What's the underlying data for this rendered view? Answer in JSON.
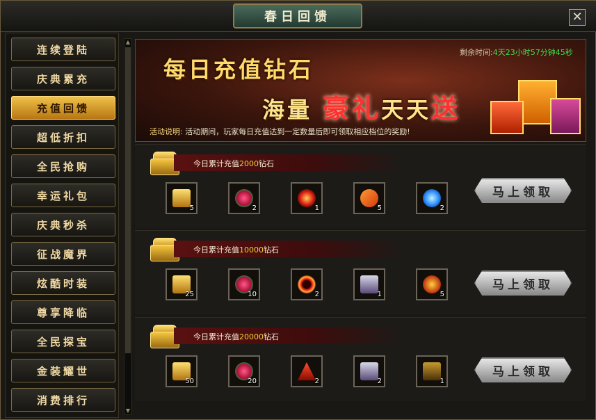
{
  "window": {
    "title": "春日回馈",
    "close_glyph": "✕"
  },
  "sidebar": {
    "items": [
      {
        "label": "连续登陆",
        "active": false
      },
      {
        "label": "庆典累充",
        "active": false
      },
      {
        "label": "充值回馈",
        "active": true
      },
      {
        "label": "超低折扣",
        "active": false
      },
      {
        "label": "全民抢购",
        "active": false
      },
      {
        "label": "幸运礼包",
        "active": false
      },
      {
        "label": "庆典秒杀",
        "active": false
      },
      {
        "label": "征战魔界",
        "active": false
      },
      {
        "label": "炫酷时装",
        "active": false
      },
      {
        "label": "尊享降临",
        "active": false
      },
      {
        "label": "全民探宝",
        "active": false
      },
      {
        "label": "金装耀世",
        "active": false
      },
      {
        "label": "消费排行",
        "active": false
      }
    ]
  },
  "banner": {
    "line1": "每日充值钻石",
    "line2_prefix": "海量",
    "line2_hot": "豪礼",
    "line2_mid": "天天",
    "line2_end": "送",
    "timer_label": "剩余时间:",
    "timer_value": "4天23小时57分钟45秒",
    "desc_label": "活动说明:",
    "desc_text": "活动期间，玩家每日充值达到一定数量后即可领取相应档位的奖励!"
  },
  "tiers": [
    {
      "prefix": "今日累计充值",
      "amount": "2000",
      "suffix": "钻石",
      "rewards": [
        {
          "icon": "gold-chest-icon",
          "count": "5"
        },
        {
          "icon": "ruby-amulet-icon",
          "count": "2"
        },
        {
          "icon": "red-orb-icon",
          "count": "1"
        },
        {
          "icon": "fire-wings-icon",
          "count": "5"
        },
        {
          "icon": "blue-crystal-icon",
          "count": "2"
        }
      ],
      "claim_label": "马上领取"
    },
    {
      "prefix": "今日累计充值",
      "amount": "10000",
      "suffix": "钻石",
      "rewards": [
        {
          "icon": "gold-chest-icon",
          "count": "25"
        },
        {
          "icon": "ruby-amulet-icon",
          "count": "10"
        },
        {
          "icon": "red-ring-icon",
          "count": "2"
        },
        {
          "icon": "silver-chest-icon",
          "count": "1"
        },
        {
          "icon": "dragon-egg-icon",
          "count": "5"
        }
      ],
      "claim_label": "马上领取"
    },
    {
      "prefix": "今日累计充值",
      "amount": "20000",
      "suffix": "钻石",
      "rewards": [
        {
          "icon": "gold-chest-icon",
          "count": "50"
        },
        {
          "icon": "ruby-amulet-icon",
          "count": "20"
        },
        {
          "icon": "red-triangle-icon",
          "count": "2"
        },
        {
          "icon": "silver-chest-icon",
          "count": "2"
        },
        {
          "icon": "dark-gold-chest-icon",
          "count": "1"
        }
      ],
      "claim_label": "马上领取"
    }
  ],
  "colors": {
    "accent_gold": "#f5d13a",
    "timer_green": "#3fe24a",
    "active_tab": "#e0a22e"
  }
}
